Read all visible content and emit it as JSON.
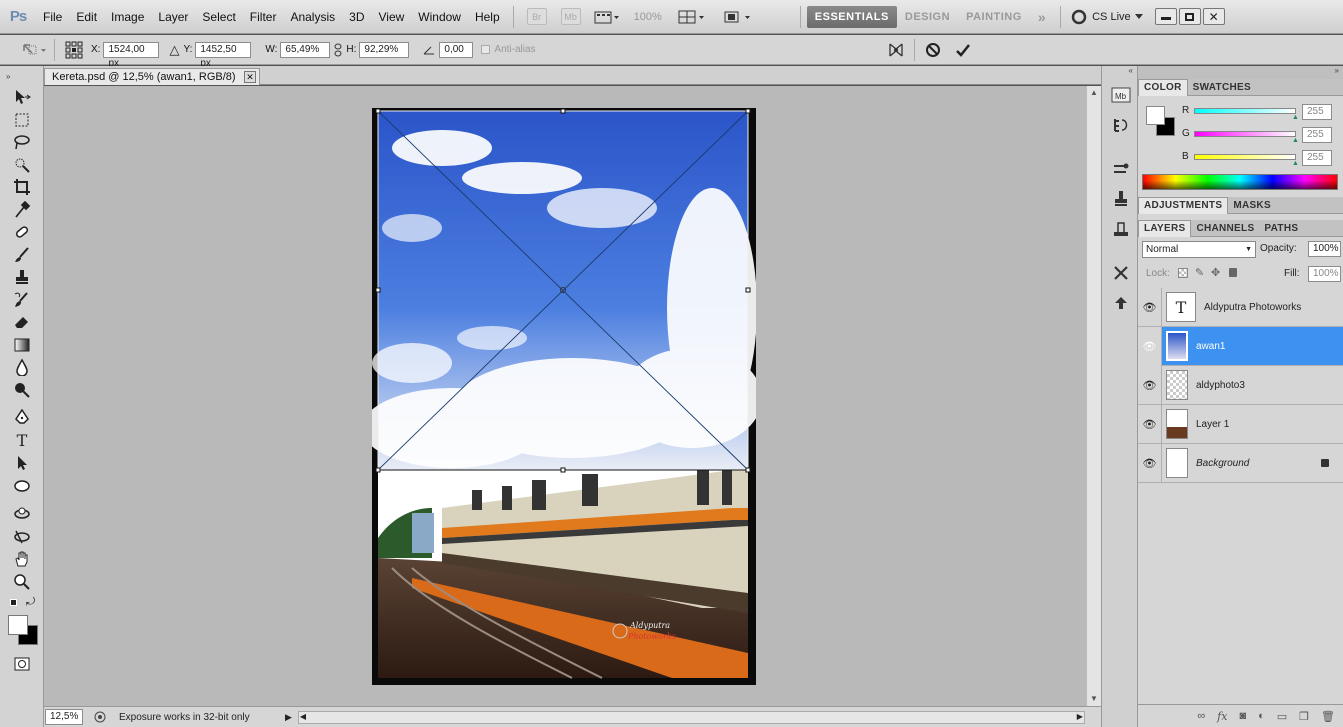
{
  "app": {
    "logo": "Ps"
  },
  "menu": [
    "File",
    "Edit",
    "Image",
    "Layer",
    "Select",
    "Filter",
    "Analysis",
    "3D",
    "View",
    "Window",
    "Help"
  ],
  "menubar": {
    "mini_buttons": [
      "Br",
      "Mb"
    ],
    "zoom": "100%",
    "workspaces": [
      "ESSENTIALS",
      "DESIGN",
      "PAINTING"
    ],
    "more": "»",
    "cslive": "CS Live"
  },
  "options": {
    "x_label": "X:",
    "x_value": "1524,00 px",
    "y_label": "Y:",
    "y_value": "1452,50 px",
    "w_label": "W:",
    "w_value": "65,49%",
    "h_label": "H:",
    "h_value": "92,29%",
    "angle_value": "0,00",
    "antialias_label": "Anti-alias",
    "cancel_icon": "cancel-icon",
    "commit_icon": "checkmark-icon"
  },
  "document": {
    "tab_title": "Kereta.psd @ 12,5% (awan1, RGB/8)",
    "watermark_line1": "Aldyputra",
    "watermark_line2": "Photoworks"
  },
  "status": {
    "zoom": "12,5%",
    "info": "Exposure works in 32-bit only"
  },
  "color_panel": {
    "tabs": [
      "COLOR",
      "SWATCHES"
    ],
    "channels": [
      {
        "label": "R",
        "value": "255",
        "color": "#ff0000"
      },
      {
        "label": "G",
        "value": "255",
        "color": "#00ff00"
      },
      {
        "label": "B",
        "value": "255",
        "color": "#0000ff"
      }
    ]
  },
  "adjust_tabs": [
    "ADJUSTMENTS",
    "MASKS"
  ],
  "layers_panel": {
    "tabs": [
      "LAYERS",
      "CHANNELS",
      "PATHS"
    ],
    "blend_mode": "Normal",
    "opacity_label": "Opacity:",
    "opacity_value": "100%",
    "lock_label": "Lock:",
    "fill_label": "Fill:",
    "fill_value": "100%",
    "layers": [
      {
        "name": "Aldyputra Photoworks",
        "type": "text",
        "selected": false
      },
      {
        "name": "awan1",
        "type": "image",
        "selected": true
      },
      {
        "name": "aldyphoto3",
        "type": "smart",
        "selected": false
      },
      {
        "name": "Layer 1",
        "type": "image",
        "selected": false
      },
      {
        "name": "Background",
        "type": "background",
        "selected": false
      }
    ]
  },
  "colors": {
    "accent": "#3d92f1",
    "sky": "#3a6fd8"
  }
}
